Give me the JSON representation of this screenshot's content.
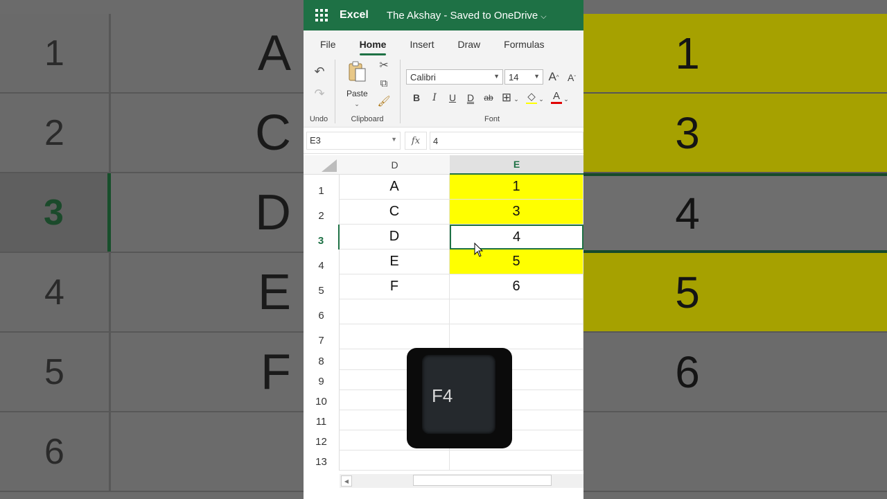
{
  "titlebar": {
    "app_name": "Excel",
    "document_title": "The Akshay - Saved to OneDrive",
    "chevron": "⌵",
    "bg_color": "#1e7145"
  },
  "tabs": [
    {
      "label": "File",
      "active": false
    },
    {
      "label": "Home",
      "active": true
    },
    {
      "label": "Insert",
      "active": false
    },
    {
      "label": "Draw",
      "active": false
    },
    {
      "label": "Formulas",
      "active": false
    }
  ],
  "ribbon": {
    "undo_group_label": "Undo",
    "clipboard_group_label": "Clipboard",
    "paste_label": "Paste",
    "font_group_label": "Font",
    "font_name": "Calibri",
    "font_size": "14",
    "grow_font": "A",
    "shrink_font": "A",
    "bold": "B",
    "italic": "I",
    "underline": "U",
    "double_underline": "D",
    "strike": "ab",
    "font_color_letter": "A",
    "fill_color": "#ffff00",
    "font_color": "#e00000"
  },
  "formula_bar": {
    "name_box": "E3",
    "fx": "fx",
    "value": "4"
  },
  "grid": {
    "columns": [
      "D",
      "E"
    ],
    "selected_column": "E",
    "selected_row": "3",
    "rows": [
      {
        "num": "1",
        "d": "A",
        "e": "1",
        "e_fill": "yellow"
      },
      {
        "num": "2",
        "d": "C",
        "e": "3",
        "e_fill": "yellow"
      },
      {
        "num": "3",
        "d": "D",
        "e": "4",
        "e_fill": "active"
      },
      {
        "num": "4",
        "d": "E",
        "e": "5",
        "e_fill": "yellow"
      },
      {
        "num": "5",
        "d": "F",
        "e": "6",
        "e_fill": "none"
      },
      {
        "num": "6",
        "d": "",
        "e": "",
        "e_fill": "none"
      },
      {
        "num": "7",
        "d": "",
        "e": "",
        "e_fill": "none"
      },
      {
        "num": "8",
        "d": "",
        "e": "",
        "e_fill": "none"
      },
      {
        "num": "9",
        "d": "",
        "e": "",
        "e_fill": "none"
      },
      {
        "num": "10",
        "d": "",
        "e": "",
        "e_fill": "none"
      },
      {
        "num": "11",
        "d": "",
        "e": "",
        "e_fill": "none"
      },
      {
        "num": "12",
        "d": "",
        "e": "",
        "e_fill": "none"
      },
      {
        "num": "13",
        "d": "",
        "e": "",
        "e_fill": "none"
      }
    ],
    "highlight_color": "#ffff00",
    "selection_color": "#1e7145"
  },
  "keycap": {
    "label": "F4"
  },
  "background": {
    "left_rows": [
      {
        "num": "1",
        "letter": "A"
      },
      {
        "num": "2",
        "letter": "C"
      },
      {
        "num": "3",
        "letter": "D"
      },
      {
        "num": "4",
        "letter": "E"
      },
      {
        "num": "5",
        "letter": "F"
      },
      {
        "num": "6",
        "letter": ""
      }
    ],
    "right_rows": [
      {
        "value": "1",
        "fill": "yellow"
      },
      {
        "value": "3",
        "fill": "yellow"
      },
      {
        "value": "4",
        "fill": "selected"
      },
      {
        "value": "5",
        "fill": "yellow"
      },
      {
        "value": "6",
        "fill": "none"
      },
      {
        "value": "",
        "fill": "none"
      }
    ]
  }
}
